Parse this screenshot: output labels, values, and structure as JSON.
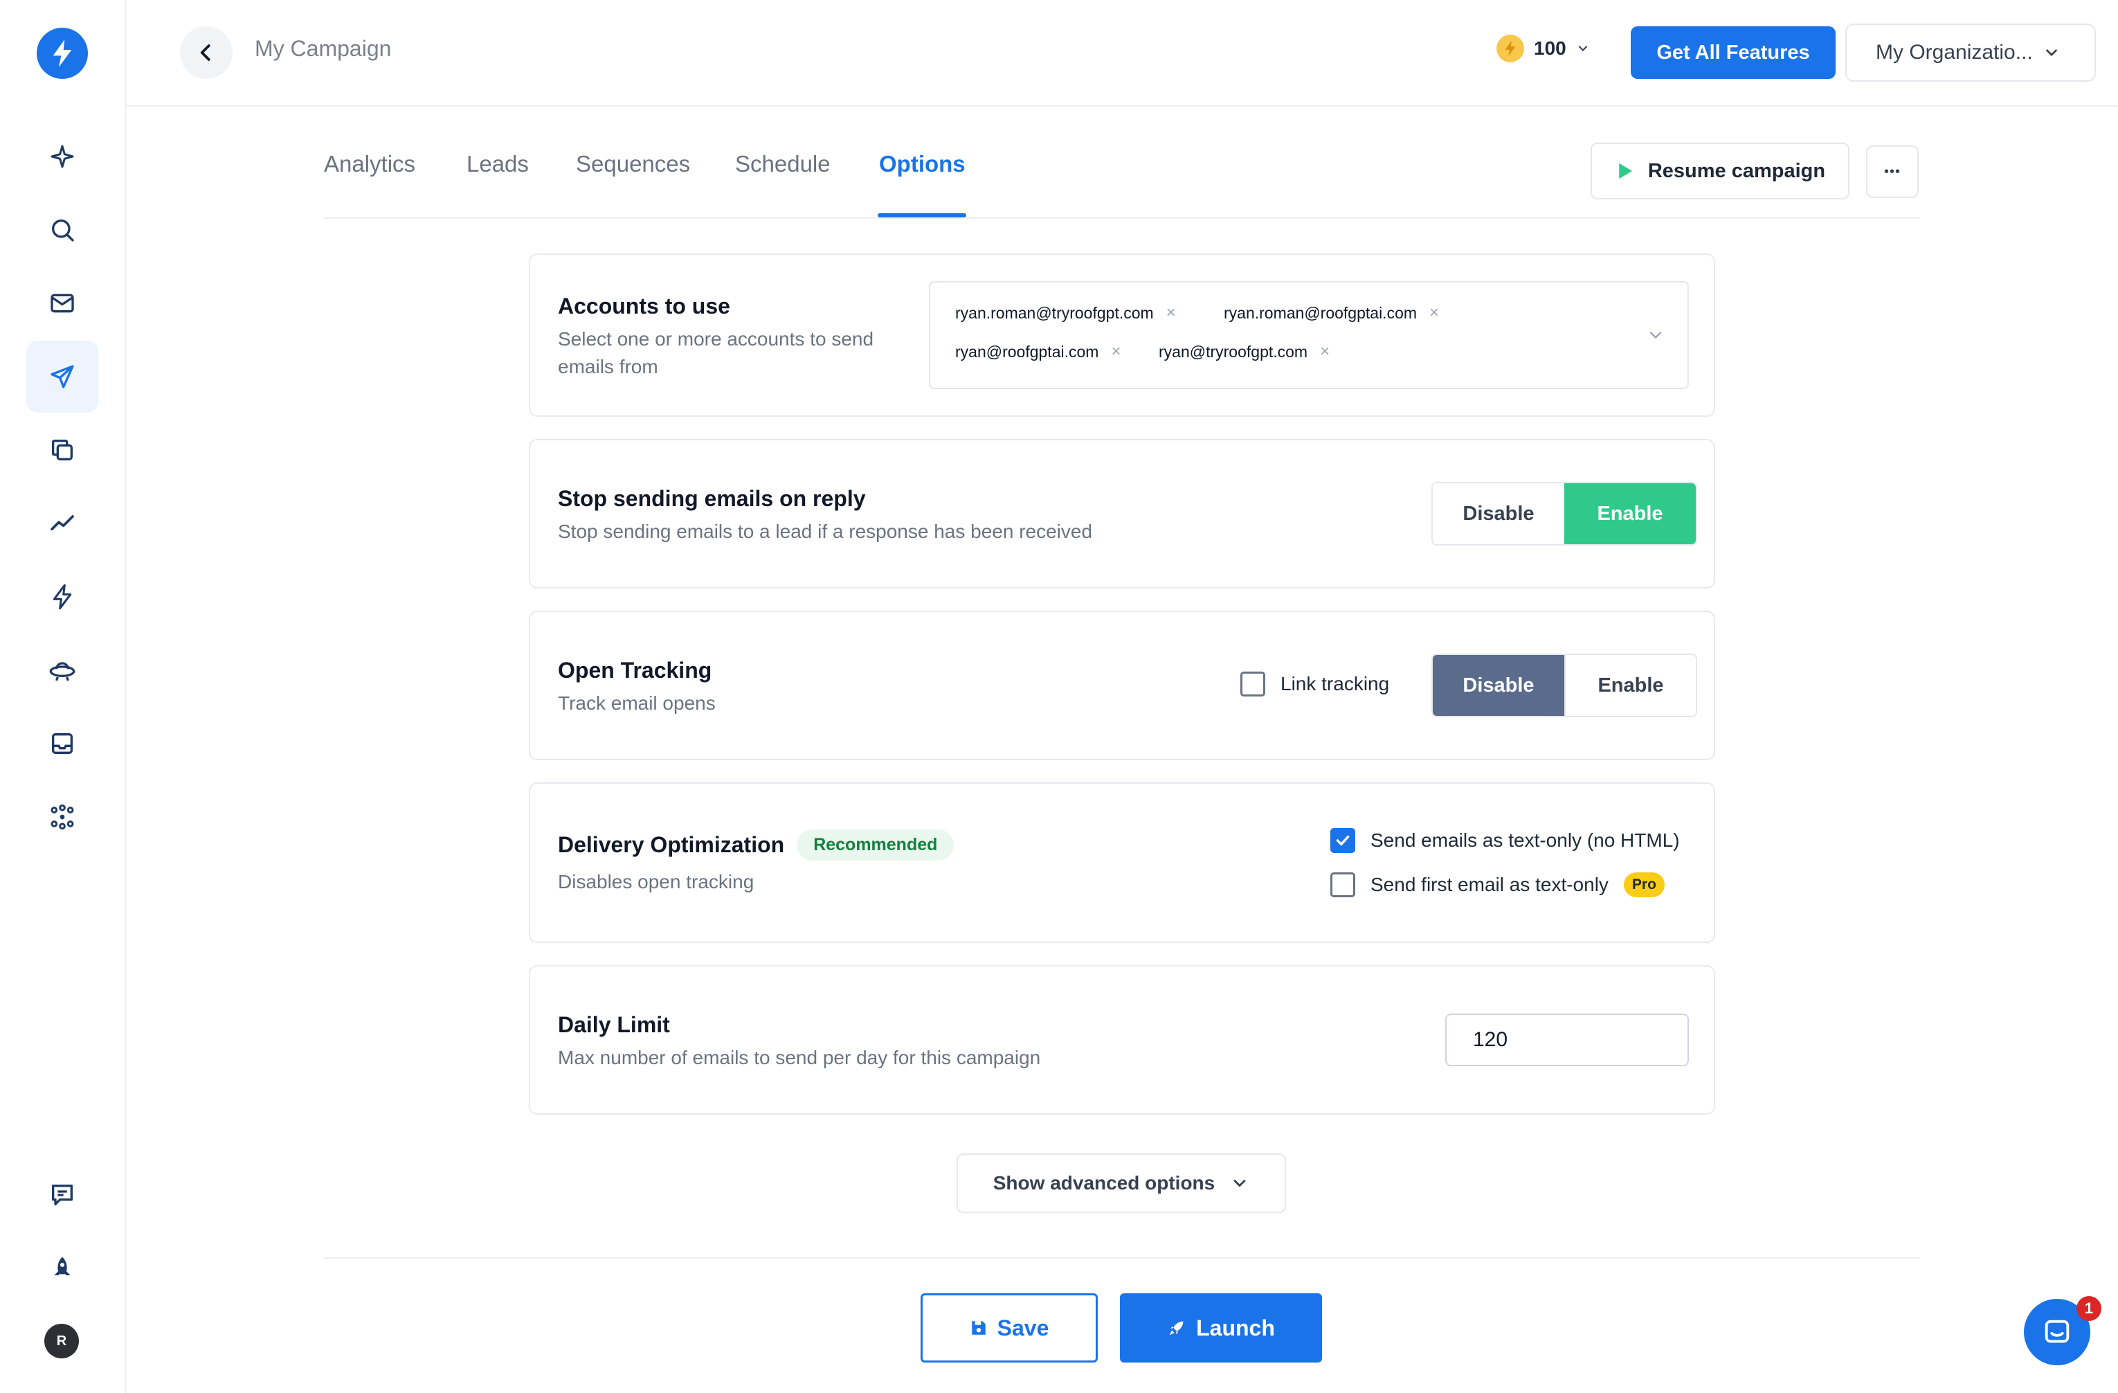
{
  "app": {
    "campaign_title": "My Campaign",
    "credits": "100",
    "get_features_label": "Get All Features",
    "org_name": "My Organizatio..."
  },
  "sidebar": {
    "items": [
      {
        "icon": "sparkle-icon"
      },
      {
        "icon": "search-icon"
      },
      {
        "icon": "mail-icon"
      },
      {
        "icon": "send-icon",
        "active": true
      },
      {
        "icon": "copy-icon"
      },
      {
        "icon": "analytics-icon"
      },
      {
        "icon": "lightning-icon"
      },
      {
        "icon": "ufo-icon"
      },
      {
        "icon": "inbox-icon"
      },
      {
        "icon": "integrations-icon"
      }
    ],
    "bottom": [
      {
        "icon": "feedback-icon"
      },
      {
        "icon": "rocket-icon"
      }
    ],
    "avatar_initial": "R"
  },
  "tabs": [
    {
      "label": "Analytics"
    },
    {
      "label": "Leads"
    },
    {
      "label": "Sequences"
    },
    {
      "label": "Schedule"
    },
    {
      "label": "Options",
      "active": true
    }
  ],
  "actions": {
    "resume_label": "Resume campaign",
    "more_label": "•••"
  },
  "accounts": {
    "title": "Accounts to use",
    "description": "Select one or more accounts to send emails from",
    "selected": [
      "ryan.roman@tryroofgpt.com",
      "ryan.roman@roofgptai.com",
      "ryan@roofgptai.com",
      "ryan@tryroofgpt.com"
    ],
    "remove_symbol": "×"
  },
  "stop_on_reply": {
    "title": "Stop sending emails on reply",
    "description": "Stop sending emails to a lead if a response has been received",
    "disable_label": "Disable",
    "enable_label": "Enable",
    "selected": "Enable"
  },
  "open_tracking": {
    "title": "Open Tracking",
    "description": "Track email opens",
    "link_tracking_label": "Link tracking",
    "link_tracking_checked": false,
    "disable_label": "Disable",
    "enable_label": "Enable",
    "selected": "Disable"
  },
  "delivery": {
    "title": "Delivery Optimization",
    "badge": "Recommended",
    "description": "Disables open tracking",
    "text_only_label": "Send emails as text-only (no HTML)",
    "text_only_checked": true,
    "first_text_only_label": "Send first email as text-only",
    "first_text_only_checked": false,
    "pro_badge": "Pro"
  },
  "daily_limit": {
    "title": "Daily Limit",
    "description": "Max number of emails to send per day for this campaign",
    "value": "120"
  },
  "advanced_label": "Show advanced options",
  "save_label": "Save",
  "launch_label": "Launch",
  "chat_unread": "1",
  "colors": {
    "primary": "#1a73e8",
    "enable_green": "#2fca8b",
    "disable_slate": "#5a6b8c",
    "pro_yellow": "#facc15"
  }
}
